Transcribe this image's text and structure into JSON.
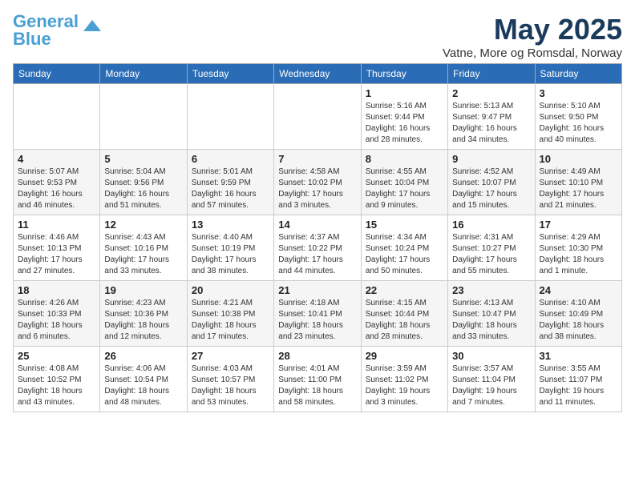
{
  "logo": {
    "line1": "General",
    "line2": "Blue"
  },
  "title": "May 2025",
  "location": "Vatne, More og Romsdal, Norway",
  "days_of_week": [
    "Sunday",
    "Monday",
    "Tuesday",
    "Wednesday",
    "Thursday",
    "Friday",
    "Saturday"
  ],
  "weeks": [
    [
      {
        "day": "",
        "info": ""
      },
      {
        "day": "",
        "info": ""
      },
      {
        "day": "",
        "info": ""
      },
      {
        "day": "",
        "info": ""
      },
      {
        "day": "1",
        "info": "Sunrise: 5:16 AM\nSunset: 9:44 PM\nDaylight: 16 hours\nand 28 minutes."
      },
      {
        "day": "2",
        "info": "Sunrise: 5:13 AM\nSunset: 9:47 PM\nDaylight: 16 hours\nand 34 minutes."
      },
      {
        "day": "3",
        "info": "Sunrise: 5:10 AM\nSunset: 9:50 PM\nDaylight: 16 hours\nand 40 minutes."
      }
    ],
    [
      {
        "day": "4",
        "info": "Sunrise: 5:07 AM\nSunset: 9:53 PM\nDaylight: 16 hours\nand 46 minutes."
      },
      {
        "day": "5",
        "info": "Sunrise: 5:04 AM\nSunset: 9:56 PM\nDaylight: 16 hours\nand 51 minutes."
      },
      {
        "day": "6",
        "info": "Sunrise: 5:01 AM\nSunset: 9:59 PM\nDaylight: 16 hours\nand 57 minutes."
      },
      {
        "day": "7",
        "info": "Sunrise: 4:58 AM\nSunset: 10:02 PM\nDaylight: 17 hours\nand 3 minutes."
      },
      {
        "day": "8",
        "info": "Sunrise: 4:55 AM\nSunset: 10:04 PM\nDaylight: 17 hours\nand 9 minutes."
      },
      {
        "day": "9",
        "info": "Sunrise: 4:52 AM\nSunset: 10:07 PM\nDaylight: 17 hours\nand 15 minutes."
      },
      {
        "day": "10",
        "info": "Sunrise: 4:49 AM\nSunset: 10:10 PM\nDaylight: 17 hours\nand 21 minutes."
      }
    ],
    [
      {
        "day": "11",
        "info": "Sunrise: 4:46 AM\nSunset: 10:13 PM\nDaylight: 17 hours\nand 27 minutes."
      },
      {
        "day": "12",
        "info": "Sunrise: 4:43 AM\nSunset: 10:16 PM\nDaylight: 17 hours\nand 33 minutes."
      },
      {
        "day": "13",
        "info": "Sunrise: 4:40 AM\nSunset: 10:19 PM\nDaylight: 17 hours\nand 38 minutes."
      },
      {
        "day": "14",
        "info": "Sunrise: 4:37 AM\nSunset: 10:22 PM\nDaylight: 17 hours\nand 44 minutes."
      },
      {
        "day": "15",
        "info": "Sunrise: 4:34 AM\nSunset: 10:24 PM\nDaylight: 17 hours\nand 50 minutes."
      },
      {
        "day": "16",
        "info": "Sunrise: 4:31 AM\nSunset: 10:27 PM\nDaylight: 17 hours\nand 55 minutes."
      },
      {
        "day": "17",
        "info": "Sunrise: 4:29 AM\nSunset: 10:30 PM\nDaylight: 18 hours\nand 1 minute."
      }
    ],
    [
      {
        "day": "18",
        "info": "Sunrise: 4:26 AM\nSunset: 10:33 PM\nDaylight: 18 hours\nand 6 minutes."
      },
      {
        "day": "19",
        "info": "Sunrise: 4:23 AM\nSunset: 10:36 PM\nDaylight: 18 hours\nand 12 minutes."
      },
      {
        "day": "20",
        "info": "Sunrise: 4:21 AM\nSunset: 10:38 PM\nDaylight: 18 hours\nand 17 minutes."
      },
      {
        "day": "21",
        "info": "Sunrise: 4:18 AM\nSunset: 10:41 PM\nDaylight: 18 hours\nand 23 minutes."
      },
      {
        "day": "22",
        "info": "Sunrise: 4:15 AM\nSunset: 10:44 PM\nDaylight: 18 hours\nand 28 minutes."
      },
      {
        "day": "23",
        "info": "Sunrise: 4:13 AM\nSunset: 10:47 PM\nDaylight: 18 hours\nand 33 minutes."
      },
      {
        "day": "24",
        "info": "Sunrise: 4:10 AM\nSunset: 10:49 PM\nDaylight: 18 hours\nand 38 minutes."
      }
    ],
    [
      {
        "day": "25",
        "info": "Sunrise: 4:08 AM\nSunset: 10:52 PM\nDaylight: 18 hours\nand 43 minutes."
      },
      {
        "day": "26",
        "info": "Sunrise: 4:06 AM\nSunset: 10:54 PM\nDaylight: 18 hours\nand 48 minutes."
      },
      {
        "day": "27",
        "info": "Sunrise: 4:03 AM\nSunset: 10:57 PM\nDaylight: 18 hours\nand 53 minutes."
      },
      {
        "day": "28",
        "info": "Sunrise: 4:01 AM\nSunset: 11:00 PM\nDaylight: 18 hours\nand 58 minutes."
      },
      {
        "day": "29",
        "info": "Sunrise: 3:59 AM\nSunset: 11:02 PM\nDaylight: 19 hours\nand 3 minutes."
      },
      {
        "day": "30",
        "info": "Sunrise: 3:57 AM\nSunset: 11:04 PM\nDaylight: 19 hours\nand 7 minutes."
      },
      {
        "day": "31",
        "info": "Sunrise: 3:55 AM\nSunset: 11:07 PM\nDaylight: 19 hours\nand 11 minutes."
      }
    ]
  ]
}
